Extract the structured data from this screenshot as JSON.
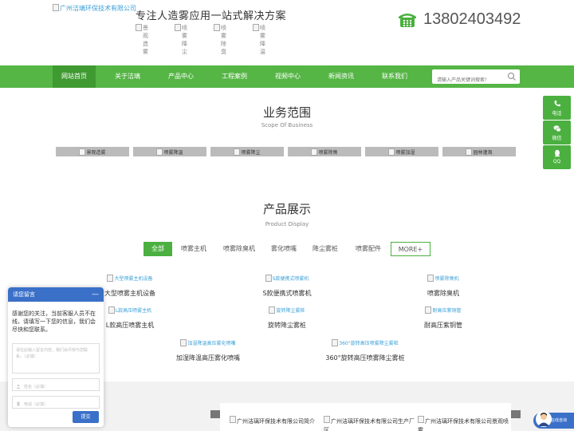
{
  "header": {
    "logo_alt": "广州洁璃环保技术有限公司",
    "slogan": "专注人造雾应用一站式解决方案",
    "tags": [
      {
        "lbl": "景观造雾",
        "lbl2": "景观造雾"
      },
      {
        "lbl": "喷雾降尘",
        "lbl2": "喷雾降尘"
      },
      {
        "lbl": "喷雾除臭",
        "lbl2": "喷雾除臭"
      },
      {
        "lbl": "喷雾降温",
        "lbl2": "喷雾降温"
      }
    ],
    "phone": "13802403492"
  },
  "nav": {
    "items": [
      "网站首页",
      "关于洁璃",
      "产品中心",
      "工程案例",
      "视频中心",
      "新闻资讯",
      "联系我们"
    ],
    "search_placeholder": "请输入产品关键词搜索！"
  },
  "business": {
    "title": "业务范围",
    "subtitle": "Scope Of Business",
    "items": [
      "景观造雾",
      "喷雾降温",
      "喷雾降尘",
      "喷雾除臭",
      "喷雾加湿",
      "园林灌溉"
    ]
  },
  "products": {
    "title": "产品展示",
    "subtitle": "Product Display",
    "tabs": [
      "全部",
      "喷雾主机",
      "喷雾除臭机",
      "雾化喷嘴",
      "降尘雾桩",
      "喷雾配件",
      "MORE+"
    ],
    "items": [
      {
        "alt": "大型喷雾主机设备",
        "name": "大型喷雾主机设备"
      },
      {
        "alt": "S款便携式喷雾机",
        "name": "S款便携式喷雾机"
      },
      {
        "alt": "喷雾除臭机",
        "name": "喷雾除臭机"
      },
      {
        "alt": "L款高压喷雾主机",
        "name": "L款高压喷雾主机"
      },
      {
        "alt": "旋转降尘雾桩",
        "name": "旋转降尘雾桩"
      },
      {
        "alt": "耐高压紫铜管",
        "name": "耐高压紫铜管"
      },
      {
        "alt": "加湿降温高压雾化喷嘴",
        "name": "加湿降温高压雾化喷嘴"
      },
      {
        "alt": "360°旋转高压喷雾降尘雾桩",
        "name": "360°旋转高压喷雾降尘雾桩"
      }
    ]
  },
  "about": {
    "items": [
      "广州洁璃环保技术有限公司简介",
      "广州洁璃环保技术有限公司生产厂区",
      "广州洁璃环保技术有限公司景观喷雾"
    ]
  },
  "float_bar": {
    "items": [
      "电话",
      "微信",
      "QQ"
    ]
  },
  "chat": {
    "title": "请您留言",
    "minimize": "—",
    "message": "感谢您的关注，当前客服人员不在线，请填写一下您的信息，我们会尽快和您联系。",
    "textarea_placeholder": "请在此输入留言内容，我们会尽快与您联系。（必填）",
    "name_placeholder": "姓名（必填）",
    "phone_placeholder": "电话（必填）",
    "submit": "提交"
  },
  "online": {
    "label": "在线咨询"
  },
  "colors": {
    "nav_green": "#55b545",
    "nav_active": "#3f9a31",
    "chat_blue": "#3b70c9"
  }
}
